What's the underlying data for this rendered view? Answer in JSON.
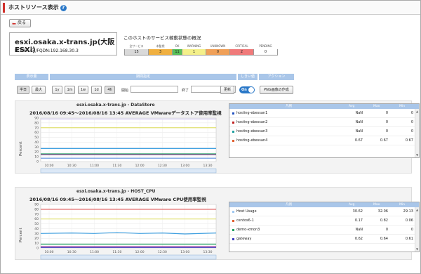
{
  "page": {
    "title": "ホストリソース表示",
    "back_label": "戻る"
  },
  "host": {
    "name": "esxi.osaka.x-trans.jp(大阪ESXi)",
    "ip_line": "IPアドレス/FQDN:192.168.30.3"
  },
  "services": {
    "title": "このホストのサービス稼動状態の概況",
    "labels": [
      "全サービス",
      "未監視",
      "OK",
      "WARNING",
      "UNKNOWN",
      "CRITICAL",
      "PENDING"
    ],
    "values": [
      "15",
      "3",
      "11",
      "1",
      "0",
      "2",
      "0"
    ],
    "colors": [
      "#d9d9d9",
      "#f0b040",
      "#58c058",
      "#f4f08a",
      "#f0a058",
      "#f07a7a",
      "#ffffff"
    ]
  },
  "controls": {
    "headers": {
      "range": "表示量",
      "period": "期間指定",
      "stack": "しきい値",
      "action": "アクション"
    },
    "range_buttons": [
      "半日",
      "最大"
    ],
    "period_buttons": [
      "1y",
      "1m",
      "1w",
      "1d",
      "4h"
    ],
    "start_label": "開始",
    "end_label": "終了",
    "update_label": "更新",
    "toggle_label": "On",
    "png_button": "PNG画像の作成"
  },
  "charts": [
    {
      "title": "esxi.osaka.x-trans.jp - DataStore",
      "subtitle": "2016/08/16 09:45～2016/08/16 13:45 AVERAGE VMwareデータストア使用率監視",
      "ylabel": "Percent",
      "legend_headers": {
        "name": "凡例",
        "avg": "Avg",
        "max": "Max",
        "min": "Min"
      },
      "rows": [
        {
          "name": "hosting-ebessan1",
          "color": "#2050c0",
          "avg": "NaN",
          "max": "0",
          "min": "0"
        },
        {
          "name": "hosting-ebessan2",
          "color": "#c02020",
          "avg": "NaN",
          "max": "0",
          "min": "0"
        },
        {
          "name": "hosting-ebessan3",
          "color": "#20a0a0",
          "avg": "NaN",
          "max": "0",
          "min": "0"
        },
        {
          "name": "hosting-ebessan4",
          "color": "#e06030",
          "avg": "0.67",
          "max": "0.67",
          "min": "0.67"
        }
      ]
    },
    {
      "title": "esxi.osaka.x-trans.jp - HOST_CPU",
      "subtitle": "2016/08/16 09:45～2016/08/16 13:45 AVERAGE VMware CPU使用率監視",
      "ylabel": "Percent",
      "legend_headers": {
        "name": "凡例",
        "avg": "Avg",
        "max": "Max",
        "min": "Min"
      },
      "rows": [
        {
          "name": "Host Usage",
          "color": "#a0c8f0",
          "avg": "30.62",
          "max": "32.06",
          "min": "29.13"
        },
        {
          "name": "centos6-1",
          "color": "#e06030",
          "avg": "0.17",
          "max": "0.82",
          "min": "0.06"
        },
        {
          "name": "demo-xmon3",
          "color": "#20a060",
          "avg": "NaN",
          "max": "0",
          "min": "0"
        },
        {
          "name": "gateway",
          "color": "#4040c0",
          "avg": "0.62",
          "max": "0.64",
          "min": "0.61"
        }
      ]
    }
  ],
  "chart_data": [
    {
      "type": "line",
      "x": [
        "10:00",
        "10:30",
        "11:00",
        "11:30",
        "12:00",
        "12:30",
        "13:00",
        "13:30"
      ],
      "ylim": [
        0,
        90
      ],
      "yticks": [
        "0",
        "10",
        "20",
        "30",
        "40",
        "50",
        "60",
        "70",
        "80",
        "90"
      ],
      "series": [
        {
          "color": "#d0c8f0",
          "values": [
            88,
            88,
            88,
            88,
            88,
            88,
            88,
            88
          ]
        },
        {
          "color": "#e0e070",
          "values": [
            70,
            70,
            70,
            70,
            70,
            70,
            70,
            70
          ]
        },
        {
          "color": "#40a0e0",
          "values": [
            27,
            27,
            27,
            27,
            27,
            27,
            27,
            27
          ]
        },
        {
          "color": "#20a060",
          "values": [
            16,
            16,
            16,
            16,
            16,
            16,
            16,
            16
          ]
        },
        {
          "color": "#a040a0",
          "values": [
            14,
            14,
            14,
            14,
            14,
            14,
            14,
            14
          ]
        },
        {
          "color": "#6090e0",
          "values": [
            7,
            7,
            7,
            7,
            7,
            7,
            7,
            7
          ]
        }
      ]
    },
    {
      "type": "line",
      "x": [
        "10:00",
        "10:30",
        "11:00",
        "11:30",
        "12:00",
        "12:30",
        "13:00",
        "13:30"
      ],
      "ylim": [
        0,
        90
      ],
      "yticks": [
        "0",
        "10",
        "20",
        "30",
        "40",
        "50",
        "60",
        "70",
        "80",
        "90"
      ],
      "series": [
        {
          "color": "#e06060",
          "values": [
            80,
            80,
            80,
            80,
            80,
            80,
            80,
            80
          ]
        },
        {
          "color": "#e0e070",
          "values": [
            60,
            60,
            60,
            60,
            60,
            60,
            60,
            60
          ]
        },
        {
          "color": "#40a0e0",
          "values": [
            30,
            31,
            30,
            32,
            30,
            31,
            29,
            31
          ]
        },
        {
          "color": "#20a060",
          "values": [
            8,
            8,
            8,
            8,
            8,
            8,
            8,
            8
          ]
        },
        {
          "color": "#a040a0",
          "values": [
            3,
            3,
            3,
            3,
            3,
            3,
            3,
            3
          ]
        },
        {
          "color": "#4040c0",
          "values": [
            1,
            1,
            1,
            1,
            1,
            1,
            1,
            1
          ]
        }
      ]
    }
  ]
}
